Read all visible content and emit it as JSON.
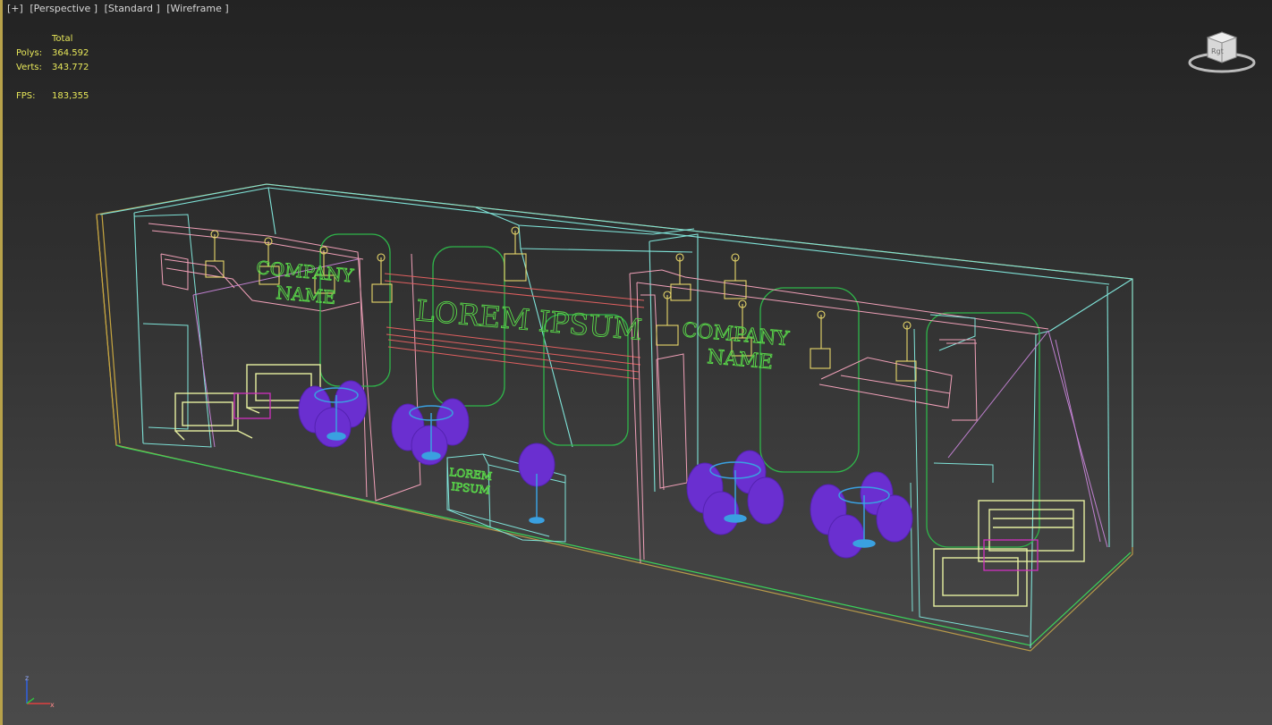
{
  "viewport": {
    "labels": [
      "[+]",
      "[Perspective ]",
      "[Standard ]",
      "[Wireframe ]"
    ]
  },
  "stats": {
    "header": "Total",
    "polys_label": "Polys:",
    "polys_value": "364.592",
    "verts_label": "Verts:",
    "verts_value": "343.772",
    "fps_label": "FPS:",
    "fps_value": "183,355"
  },
  "scene": {
    "sign_left": [
      "COMPANY",
      "NAME"
    ],
    "sign_center": "LOREM IPSUM",
    "sign_right": [
      "COMPANY",
      "NAME"
    ],
    "counter_sign": [
      "LOREM",
      "IPSUM"
    ]
  },
  "viewcube": {
    "label": "Rgt"
  },
  "axis": {
    "z_label": "z",
    "x_label": "x"
  },
  "colors": {
    "wire_green": "#3bd35a",
    "wire_cyan": "#7fe3d8",
    "wire_pink": "#f0a0b8",
    "wire_yellow": "#e8d76a",
    "text_green": "#5adc4a",
    "furniture_purple": "#6a2fd0",
    "table_blue": "#3aa0e0",
    "sofa_yellow": "#e6efa0",
    "stats_yellow": "#e8e85a"
  }
}
